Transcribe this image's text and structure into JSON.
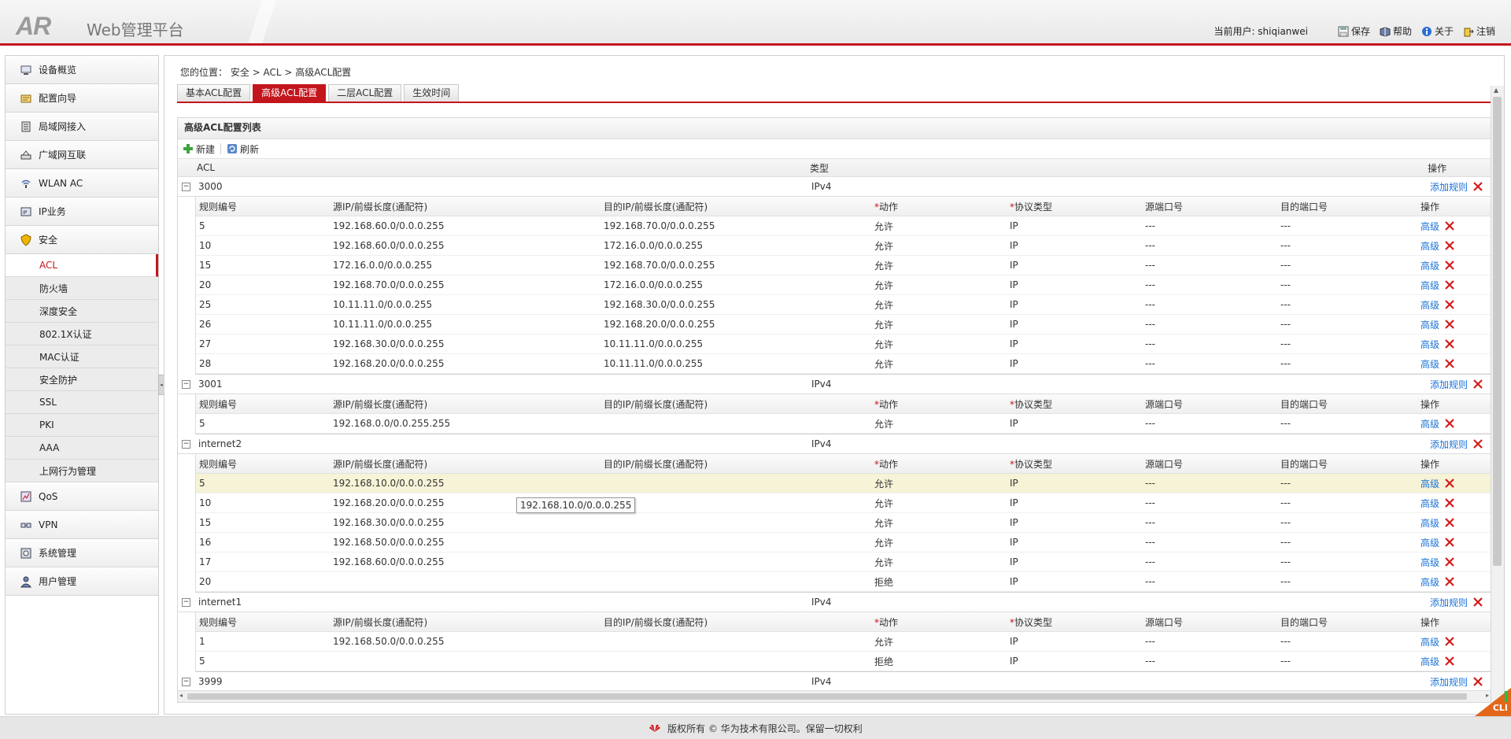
{
  "header": {
    "logo": "AR",
    "title": "Web管理平台",
    "user_label": "当前用户: shiqianwei",
    "actions": [
      "保存",
      "帮助",
      "关于",
      "注销"
    ]
  },
  "sidebar": {
    "items": [
      {
        "label": "设备概览",
        "icon": "device-overview-icon"
      },
      {
        "label": "配置向导",
        "icon": "wizard-icon"
      },
      {
        "label": "局域网接入",
        "icon": "lan-icon"
      },
      {
        "label": "广域网互联",
        "icon": "wan-icon"
      },
      {
        "label": "WLAN AC",
        "icon": "wlan-icon"
      },
      {
        "label": "IP业务",
        "icon": "ip-service-icon"
      },
      {
        "label": "安全",
        "icon": "shield-icon"
      }
    ],
    "security_sub": [
      "ACL",
      "防火墙",
      "深度安全",
      "802.1X认证",
      "MAC认证",
      "安全防护",
      "SSL",
      "PKI",
      "AAA",
      "上网行为管理"
    ],
    "items_after": [
      {
        "label": "QoS",
        "icon": "qos-icon"
      },
      {
        "label": "VPN",
        "icon": "vpn-icon"
      },
      {
        "label": "系统管理",
        "icon": "system-icon"
      },
      {
        "label": "用户管理",
        "icon": "user-mgmt-icon"
      }
    ]
  },
  "breadcrumb": "您的位置：  安全 > ACL > 高级ACL配置",
  "tabs": [
    "基本ACL配置",
    "高级ACL配置",
    "二层ACL配置",
    "生效时间"
  ],
  "panel": {
    "title": "高级ACL配置列表",
    "new_label": "新建",
    "refresh_label": "刷新"
  },
  "grid_header": {
    "acl": "ACL",
    "type": "类型",
    "ops": "操作"
  },
  "sub_header": {
    "rule": "规则编号",
    "src": "源IP/前缀长度(通配符)",
    "dst": "目的IP/前缀长度(通配符)",
    "star": "*",
    "action": "动作",
    "proto": "协议类型",
    "sport": "源端口号",
    "dport": "目的端口号",
    "ops": "操作"
  },
  "add_rule_label": "添加规则",
  "adv_label": "高级",
  "groups": [
    {
      "name": "3000",
      "type": "IPv4",
      "rows": [
        {
          "id": "5",
          "src": "192.168.60.0/0.0.0.255",
          "dst": "192.168.70.0/0.0.0.255",
          "action": "允许",
          "proto": "IP",
          "sport": "---",
          "dport": "---"
        },
        {
          "id": "10",
          "src": "192.168.60.0/0.0.0.255",
          "dst": "172.16.0.0/0.0.0.255",
          "action": "允许",
          "proto": "IP",
          "sport": "---",
          "dport": "---"
        },
        {
          "id": "15",
          "src": "172.16.0.0/0.0.0.255",
          "dst": "192.168.70.0/0.0.0.255",
          "action": "允许",
          "proto": "IP",
          "sport": "---",
          "dport": "---"
        },
        {
          "id": "20",
          "src": "192.168.70.0/0.0.0.255",
          "dst": "172.16.0.0/0.0.0.255",
          "action": "允许",
          "proto": "IP",
          "sport": "---",
          "dport": "---"
        },
        {
          "id": "25",
          "src": "10.11.11.0/0.0.0.255",
          "dst": "192.168.30.0/0.0.0.255",
          "action": "允许",
          "proto": "IP",
          "sport": "---",
          "dport": "---"
        },
        {
          "id": "26",
          "src": "10.11.11.0/0.0.0.255",
          "dst": "192.168.20.0/0.0.0.255",
          "action": "允许",
          "proto": "IP",
          "sport": "---",
          "dport": "---"
        },
        {
          "id": "27",
          "src": "192.168.30.0/0.0.0.255",
          "dst": "10.11.11.0/0.0.0.255",
          "action": "允许",
          "proto": "IP",
          "sport": "---",
          "dport": "---"
        },
        {
          "id": "28",
          "src": "192.168.20.0/0.0.0.255",
          "dst": "10.11.11.0/0.0.0.255",
          "action": "允许",
          "proto": "IP",
          "sport": "---",
          "dport": "---"
        }
      ]
    },
    {
      "name": "3001",
      "type": "IPv4",
      "rows": [
        {
          "id": "5",
          "src": "192.168.0.0/0.0.255.255",
          "dst": "",
          "action": "允许",
          "proto": "IP",
          "sport": "---",
          "dport": "---"
        }
      ]
    },
    {
      "name": "internet2",
      "type": "IPv4",
      "rows": [
        {
          "id": "5",
          "src": "192.168.10.0/0.0.0.255",
          "dst": "",
          "action": "允许",
          "proto": "IP",
          "sport": "---",
          "dport": "---"
        },
        {
          "id": "10",
          "src": "192.168.20.0/0.0.0.255",
          "dst": "",
          "action": "允许",
          "proto": "IP",
          "sport": "---",
          "dport": "---"
        },
        {
          "id": "15",
          "src": "192.168.30.0/0.0.0.255",
          "dst": "",
          "action": "允许",
          "proto": "IP",
          "sport": "---",
          "dport": "---"
        },
        {
          "id": "16",
          "src": "192.168.50.0/0.0.0.255",
          "dst": "",
          "action": "允许",
          "proto": "IP",
          "sport": "---",
          "dport": "---"
        },
        {
          "id": "17",
          "src": "192.168.60.0/0.0.0.255",
          "dst": "",
          "action": "允许",
          "proto": "IP",
          "sport": "---",
          "dport": "---"
        },
        {
          "id": "20",
          "src": "",
          "dst": "",
          "action": "拒绝",
          "proto": "IP",
          "sport": "---",
          "dport": "---"
        }
      ]
    },
    {
      "name": "internet1",
      "type": "IPv4",
      "rows": [
        {
          "id": "1",
          "src": "192.168.50.0/0.0.0.255",
          "dst": "",
          "action": "允许",
          "proto": "IP",
          "sport": "---",
          "dport": "---"
        },
        {
          "id": "5",
          "src": "",
          "dst": "",
          "action": "拒绝",
          "proto": "IP",
          "sport": "---",
          "dport": "---"
        }
      ]
    },
    {
      "name": "3999",
      "type": "IPv4",
      "rows": []
    }
  ],
  "tooltip": "192.168.10.0/0.0.0.255",
  "footer": "版权所有 © 华为技术有限公司。保留一切权利",
  "cli_label": "CLI",
  "colors": {
    "accent": "#c3161c",
    "link": "#1a73d9",
    "highlight": "#f6f3d6"
  }
}
